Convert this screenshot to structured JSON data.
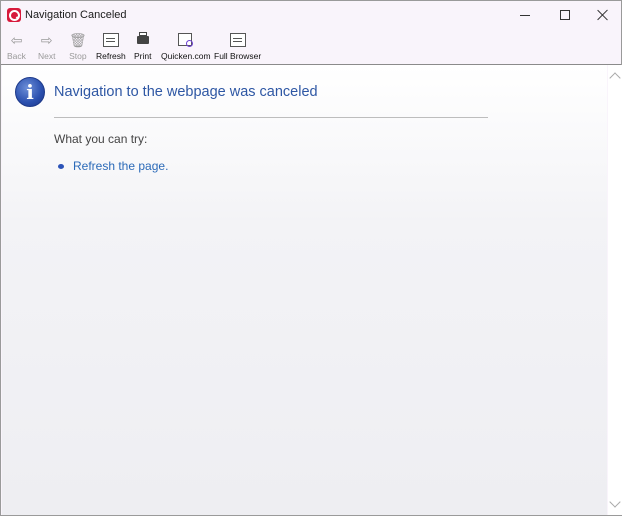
{
  "window": {
    "title": "Navigation Canceled"
  },
  "toolbar": {
    "back": "Back",
    "next": "Next",
    "stop": "Stop",
    "refresh": "Refresh",
    "print": "Print",
    "quicken": "Quicken.com",
    "full_browser": "Full Browser"
  },
  "content": {
    "heading": "Navigation to the webpage was canceled",
    "try_label": "What you can try:",
    "suggestions": [
      "Refresh the page."
    ]
  },
  "icons": {
    "app": "quicken-logo-icon",
    "info": "info-icon"
  },
  "colors": {
    "heading": "#2e57a4",
    "link": "#2b6ab8",
    "brand": "#d7193b"
  }
}
